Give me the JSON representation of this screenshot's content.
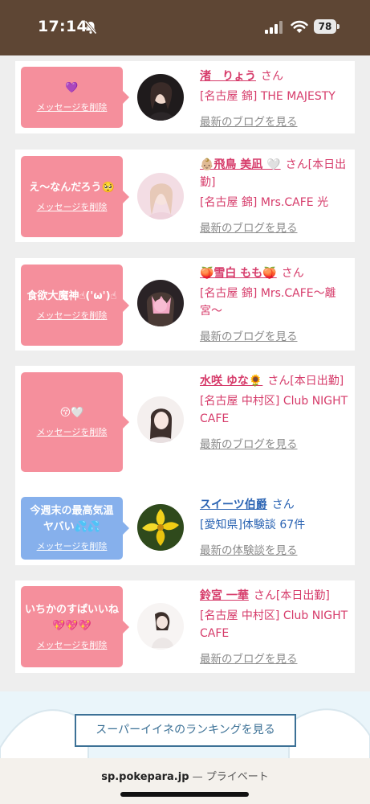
{
  "status_bar": {
    "time": "17:14",
    "battery": "78"
  },
  "messages": [
    {
      "message": "💜",
      "delete_label": "メッセージを削除",
      "bubble_color": "pink",
      "name": "渚　りょう",
      "name_suffix": "",
      "san": "さん",
      "shop": "[名古屋 錦] THE MAJESTY",
      "link": "最新のブログを見る",
      "theme": "pink"
    },
    {
      "message": "え〜なんだろう🥺",
      "delete_label": "メッセージを削除",
      "bubble_color": "pink",
      "name": "👶🏼飛鳥 美凪 🤍",
      "name_suffix": "",
      "san": "さん[本日出勤]",
      "shop": "[名古屋 錦] Mrs.CAFE 光",
      "link": "最新のブログを見る",
      "theme": "pink"
    },
    {
      "message": "食欲大魔神☝︎('ω')☝︎",
      "delete_label": "メッセージを削除",
      "bubble_color": "pink",
      "name": "🍑雪白 もも🍑",
      "name_suffix": "",
      "san": "さん",
      "shop": "[名古屋 錦] Mrs.CAFE〜離宮〜",
      "link": "最新のブログを見る",
      "theme": "pink"
    },
    {
      "message": "😚🤍",
      "delete_label": "メッセージを削除",
      "bubble_color": "pink",
      "name": "水咲 ゆな🌻",
      "name_suffix": "",
      "san": "さん[本日出勤]",
      "shop": "[名古屋 中村区] Club NIGHT CAFE",
      "link": "最新のブログを見る",
      "theme": "pink"
    },
    {
      "message": "今週末の最高気温\nヤバい💦💦",
      "delete_label": "メッセージを削除",
      "bubble_color": "blue",
      "name": "スイーツ伯爵",
      "name_suffix": "",
      "san": "さん",
      "shop": "[愛知県]体験談 67件",
      "link": "最新の体験談を見る",
      "theme": "blue"
    },
    {
      "message": "いちかのすぱいいね💖💖💖",
      "delete_label": "メッセージを削除",
      "bubble_color": "pink",
      "name": "鈴宮 一華",
      "name_suffix": "",
      "san": "さん[本日出勤]",
      "shop": "[名古屋 中村区] Club NIGHT CAFE",
      "link": "最新のブログを見る",
      "theme": "pink"
    }
  ],
  "ranking_button": "スーパーイイネのランキングを見る",
  "url_bar": {
    "domain": "sp.pokepara.jp",
    "separator": " — ",
    "label": "プライベート"
  }
}
